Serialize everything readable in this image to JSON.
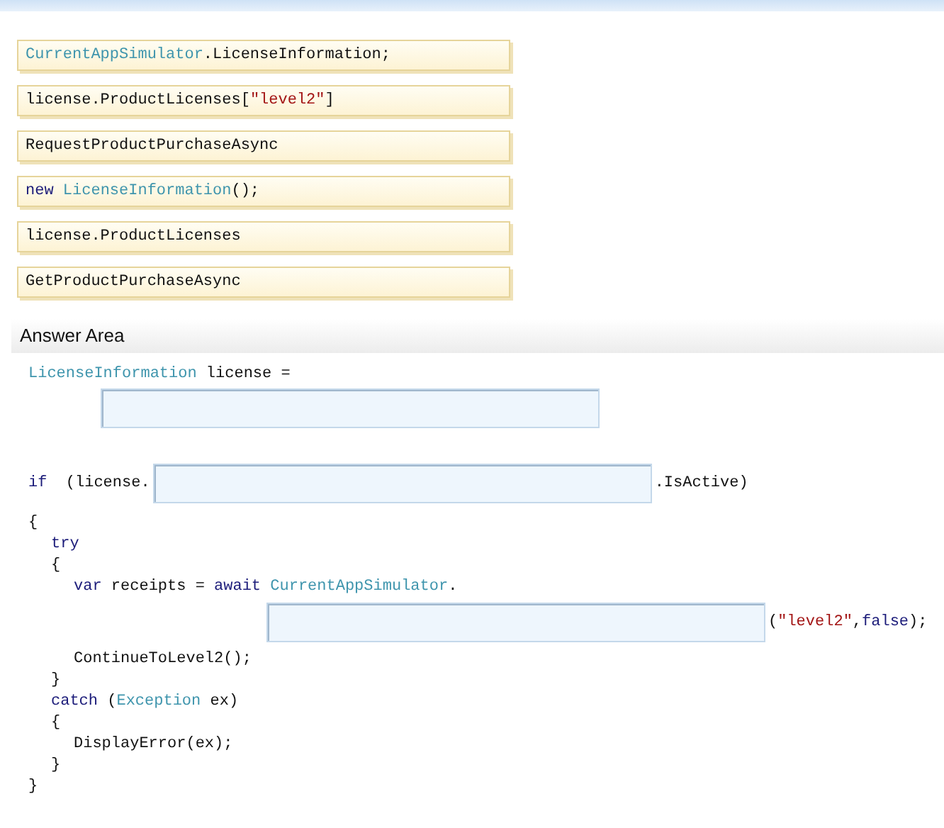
{
  "options": [
    {
      "tokens": [
        {
          "kind": "type",
          "text": "CurrentAppSimulator"
        },
        {
          "kind": "plain",
          "text": ".LicenseInformation;"
        }
      ]
    },
    {
      "tokens": [
        {
          "kind": "plain",
          "text": "license.ProductLicenses["
        },
        {
          "kind": "string",
          "text": "\"level2\""
        },
        {
          "kind": "plain",
          "text": "]"
        }
      ]
    },
    {
      "tokens": [
        {
          "kind": "plain",
          "text": "RequestProductPurchaseAsync"
        }
      ]
    },
    {
      "tokens": [
        {
          "kind": "keyword",
          "text": "new"
        },
        {
          "kind": "type",
          "text": " LicenseInformation"
        },
        {
          "kind": "plain",
          "text": "();"
        }
      ]
    },
    {
      "tokens": [
        {
          "kind": "plain",
          "text": "license.ProductLicenses"
        }
      ]
    },
    {
      "tokens": [
        {
          "kind": "plain",
          "text": "GetProductPurchaseAsync"
        }
      ]
    }
  ],
  "answer_area": {
    "title": "Answer Area",
    "lines": [
      {
        "kind": "code",
        "tokens": [
          {
            "kind": "type",
            "text": "LicenseInformation"
          },
          {
            "kind": "plain",
            "text": " license ="
          }
        ],
        "children": [
          {
            "kind": "field",
            "tokens": [
              {
                "kind": "blank"
              }
            ]
          }
        ]
      },
      {
        "kind": "spaced",
        "tokens": [
          {
            "kind": "keyword",
            "text": "if"
          },
          {
            "kind": "plain",
            "text": "  (license."
          },
          {
            "kind": "blank"
          },
          {
            "kind": "plain",
            "text": ".IsActive)"
          }
        ]
      },
      {
        "kind": "code",
        "tokens": [
          {
            "kind": "plain",
            "text": "{"
          }
        ],
        "children": [
          {
            "kind": "code",
            "tokens": [
              {
                "kind": "keyword",
                "text": "try"
              }
            ]
          },
          {
            "kind": "code",
            "tokens": [
              {
                "kind": "plain",
                "text": "{"
              }
            ],
            "children": [
              {
                "kind": "code",
                "tokens": [
                  {
                    "kind": "keyword",
                    "text": "var"
                  },
                  {
                    "kind": "plain",
                    "text": " receipts = "
                  },
                  {
                    "kind": "keyword",
                    "text": "await"
                  },
                  {
                    "kind": "type",
                    "text": " CurrentAppSimulator"
                  },
                  {
                    "kind": "plain",
                    "text": "."
                  }
                ],
                "children": [
                  {
                    "kind": "continuation",
                    "tokens": [
                      {
                        "kind": "blank"
                      },
                      {
                        "kind": "plain",
                        "text": "("
                      },
                      {
                        "kind": "string",
                        "text": "\"level2\""
                      },
                      {
                        "kind": "plain",
                        "text": ","
                      },
                      {
                        "kind": "keyword",
                        "text": "false"
                      },
                      {
                        "kind": "plain",
                        "text": ");"
                      }
                    ]
                  }
                ]
              },
              {
                "kind": "code",
                "tokens": [
                  {
                    "kind": "plain",
                    "text": "ContinueToLevel2();"
                  }
                ]
              }
            ]
          },
          {
            "kind": "code",
            "tokens": [
              {
                "kind": "plain",
                "text": "}"
              }
            ]
          },
          {
            "kind": "code",
            "tokens": [
              {
                "kind": "keyword",
                "text": "catch"
              },
              {
                "kind": "plain",
                "text": " ("
              },
              {
                "kind": "type",
                "text": "Exception"
              },
              {
                "kind": "plain",
                "text": " ex)"
              }
            ]
          },
          {
            "kind": "code",
            "tokens": [
              {
                "kind": "plain",
                "text": "{"
              }
            ],
            "children": [
              {
                "kind": "code",
                "tokens": [
                  {
                    "kind": "plain",
                    "text": "DisplayError(ex);"
                  }
                ]
              }
            ]
          },
          {
            "kind": "code",
            "tokens": [
              {
                "kind": "plain",
                "text": "}"
              }
            ]
          }
        ]
      },
      {
        "kind": "code",
        "tokens": [
          {
            "kind": "plain",
            "text": "}"
          }
        ]
      }
    ]
  }
}
